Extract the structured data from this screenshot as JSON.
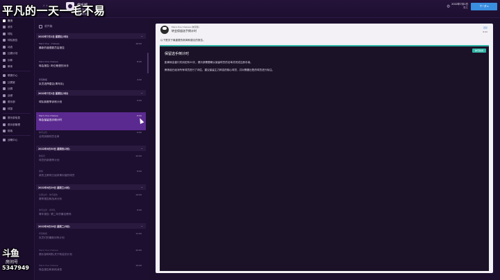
{
  "overlay": {
    "title": "平凡的一天一毛不易"
  },
  "topbar": {
    "nav": "‹ ›",
    "club_name": "俱乐部",
    "club_sub": "阿仑斯堡",
    "club_sub2": "澳洲超级",
    "date_line1": "2022年7月1日",
    "date_line2": "周五",
    "continue": "下一步 ▸",
    "corner": "…"
  },
  "sidebar": {
    "items": [
      {
        "label": "首页"
      },
      {
        "label": "收件"
      },
      {
        "label": "球队"
      },
      {
        "label": "球队报告"
      },
      {
        "label": "动态"
      },
      {
        "label": "比赛计划"
      },
      {
        "label": "训练"
      },
      {
        "label": "教练"
      },
      {
        "label": "联赛中心"
      },
      {
        "label": "比赛室"
      },
      {
        "label": "比赛"
      },
      {
        "label": "战绩"
      },
      {
        "label": "俱乐部"
      },
      {
        "label": "球探"
      },
      {
        "label": "俱乐部信息"
      },
      {
        "label": "俱乐部管理"
      },
      {
        "label": "财政"
      },
      {
        "label": "战略中心"
      }
    ],
    "logo_big": "斗鱼",
    "logo_sub": "房间号",
    "logo_num": "5347949"
  },
  "inbox": {
    "header": "收件箱",
    "groups": [
      {
        "head": "2022年7月1日 星期五(3封)",
        "messages": [
          {
            "from": "Mario Poe · Chelsea",
            "time": "16:00",
            "subj": "最新的道德委员会报告",
            "sel": false,
            "dim": false
          },
          {
            "from": "Mario Poe Chelsea",
            "time": "8:00",
            "subj": "转会报告: 阿仑斯堡的对手",
            "sel": false,
            "dim": false
          },
          {
            "from": "年轻教练",
            "time": "4:00",
            "subj": "队员选择建议(青年队)",
            "sel": false,
            "dim": false
          }
        ]
      },
      {
        "head": "2022年7月1日 星期五(3封)",
        "messages": [
          {
            "from": "",
            "time": "0:00",
            "subj": "球队新赛季训练计划",
            "sel": false,
            "dim": false
          },
          {
            "from": "Mario Poe Chelsea",
            "time": "8:00",
            "subj": "转会保留选手倒计时",
            "sel": true,
            "dim": false
          },
          {
            "from": "体育主管",
            "time": "0:00",
            "subj": "合同到期球员名单",
            "sel": false,
            "dim": true
          }
        ]
      },
      {
        "head": "2022年6月30日 星期四(2封)",
        "messages": [
          {
            "from": "教练员",
            "time": "22:00",
            "subj": "球员的新赛季计划",
            "sel": false,
            "dim": true
          },
          {
            "from": "助教",
            "time": "8:00",
            "subj": "新的主教练已经将青训营的球员",
            "sel": false,
            "dim": true
          }
        ]
      },
      {
        "head": "2022年6月29日 星期三(4封)",
        "messages": [
          {
            "from": "比赛主管 · 体育报告",
            "time": "14:00",
            "subj": "赛季报告和战术分析",
            "sel": false,
            "dim": true
          },
          {
            "from": "体育主管 · 青年队",
            "time": "9:00",
            "subj": "青年报告: 第二年的最佳教练",
            "sel": false,
            "dim": true
          }
        ]
      },
      {
        "head": "2022年6月28日 星期二(5封)",
        "messages": [
          {
            "from": "年轻教练",
            "time": "11:00",
            "subj": "队员们的最新训练计划",
            "sel": false,
            "dim": true
          },
          {
            "from": "Mario Poe Chelsea",
            "time": "22:00",
            "subj": "俱乐部和球队关于转会的计划",
            "sel": false,
            "dim": true
          },
          {
            "from": "Mario Poe Chelsea",
            "time": "19:00",
            "subj": "转会报告和其他消息",
            "sel": false,
            "dim": true
          }
        ]
      }
    ]
  },
  "detail": {
    "from": "Mario Poe Chelsea (体育部)",
    "subject": "转会保留选手倒计时",
    "right1": "回复",
    "right2": "8:00",
    "intro": "以下是关于最重要的新闻和建议的报告。",
    "badge": "体育新闻",
    "title": "保留选手倒计时",
    "p1": "距离转会窗口关闭还有20天，俱乐部需要确认保留球员的名单并完成注册手续。",
    "p2": "教练组已经对所有球员进行了评估，建议保留主力阵容的核心球员，并对需要出售的球员进行标注。"
  }
}
